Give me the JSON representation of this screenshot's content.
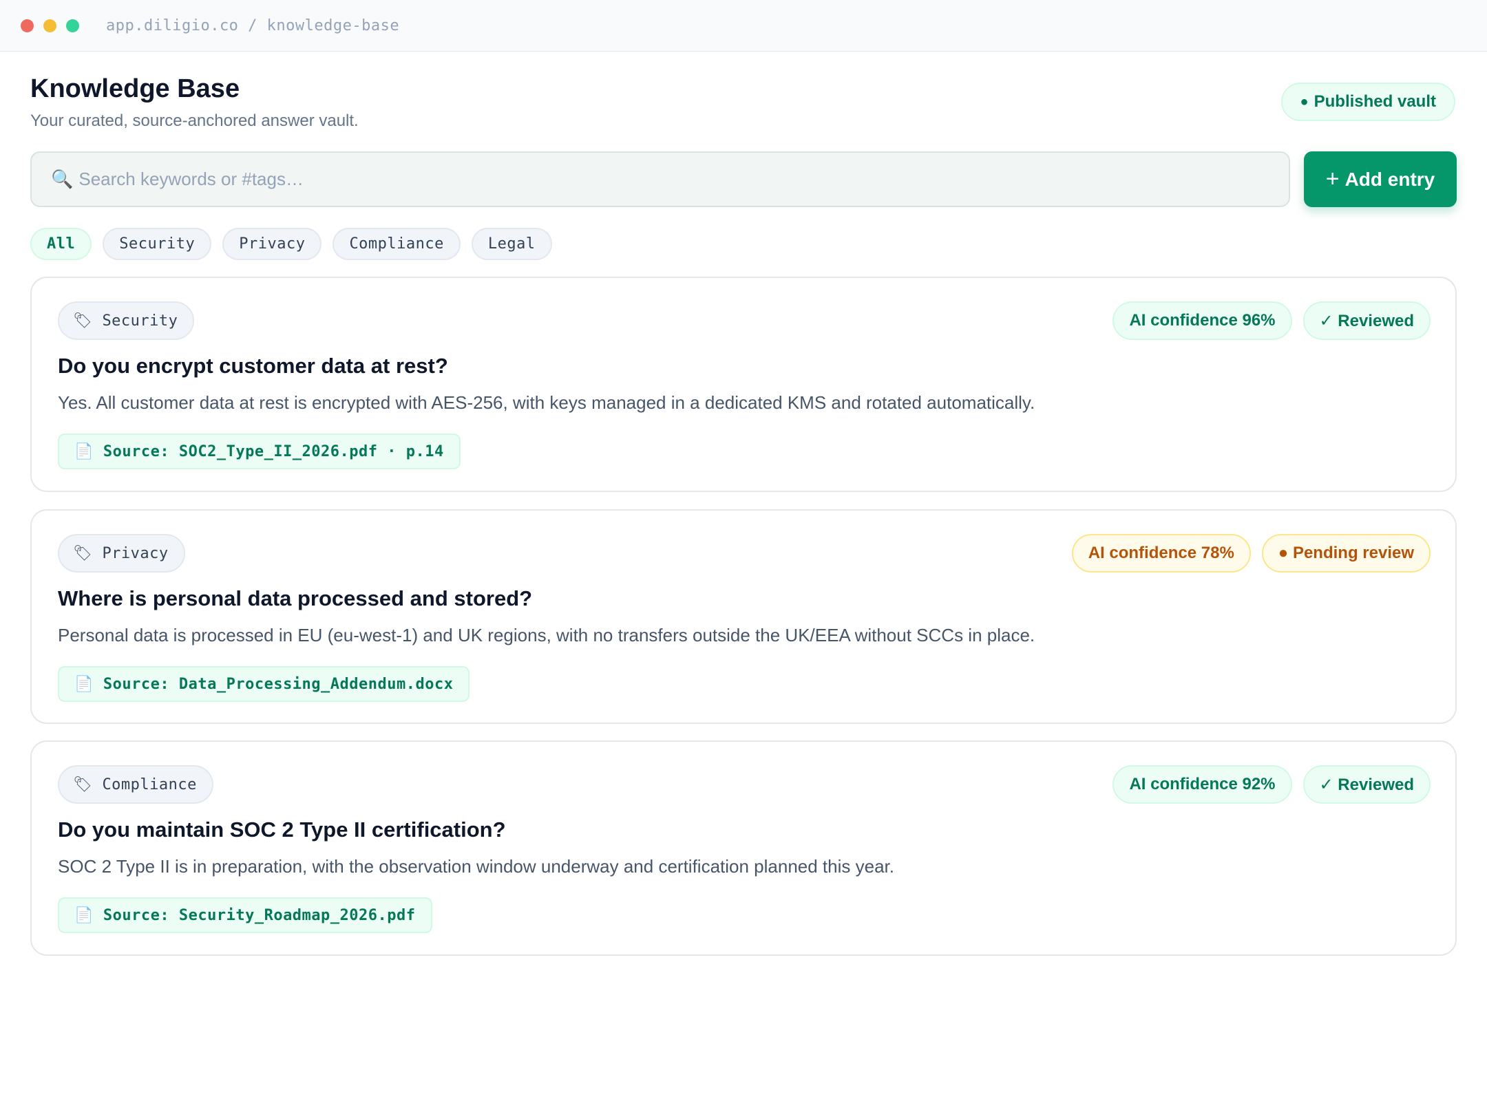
{
  "browser": {
    "url": "app.diligio.co / knowledge-base"
  },
  "header": {
    "title": "Knowledge Base",
    "subtitle": "Your curated, source-anchored answer vault.",
    "vault_badge": "Published vault"
  },
  "search": {
    "placeholder": "Search keywords or #tags…",
    "value": ""
  },
  "add_button": {
    "label": "Add entry"
  },
  "filters": [
    {
      "label": "All",
      "active": true
    },
    {
      "label": "Security",
      "active": false
    },
    {
      "label": "Privacy",
      "active": false
    },
    {
      "label": "Compliance",
      "active": false
    },
    {
      "label": "Legal",
      "active": false
    }
  ],
  "entries": [
    {
      "tag": "Security",
      "confidence": "AI confidence 96%",
      "status": "✓ Reviewed",
      "question": "Do you encrypt customer data at rest?",
      "answer": "Yes. All customer data at rest is encrypted with AES-256, with keys managed in a dedicated KMS and rotated automatically.",
      "source": "Source: SOC2_Type_II_2026.pdf · p.14"
    },
    {
      "tag": "Privacy",
      "confidence": "AI confidence 78%",
      "status": "● Pending review",
      "question": "Where is personal data processed and stored?",
      "answer": "Personal data is processed in EU (eu-west-1) and UK regions, with no transfers outside the UK/EEA without SCCs in place.",
      "source": "Source: Data_Processing_Addendum.docx"
    },
    {
      "tag": "Compliance",
      "confidence": "AI confidence 92%",
      "status": "✓ Reviewed",
      "question": "Do you maintain SOC 2 Type II certification?",
      "answer": "SOC 2 Type II is in preparation, with the observation window underway and certification planned this year.",
      "source": "Source: Security_Roadmap_2026.pdf"
    }
  ],
  "colors": {
    "accent": "#059669",
    "accent_text": "#047857",
    "reviewed_bg": "#ecfdf5",
    "pending_bg": "#fffbeb",
    "pending_text": "#b45309"
  }
}
